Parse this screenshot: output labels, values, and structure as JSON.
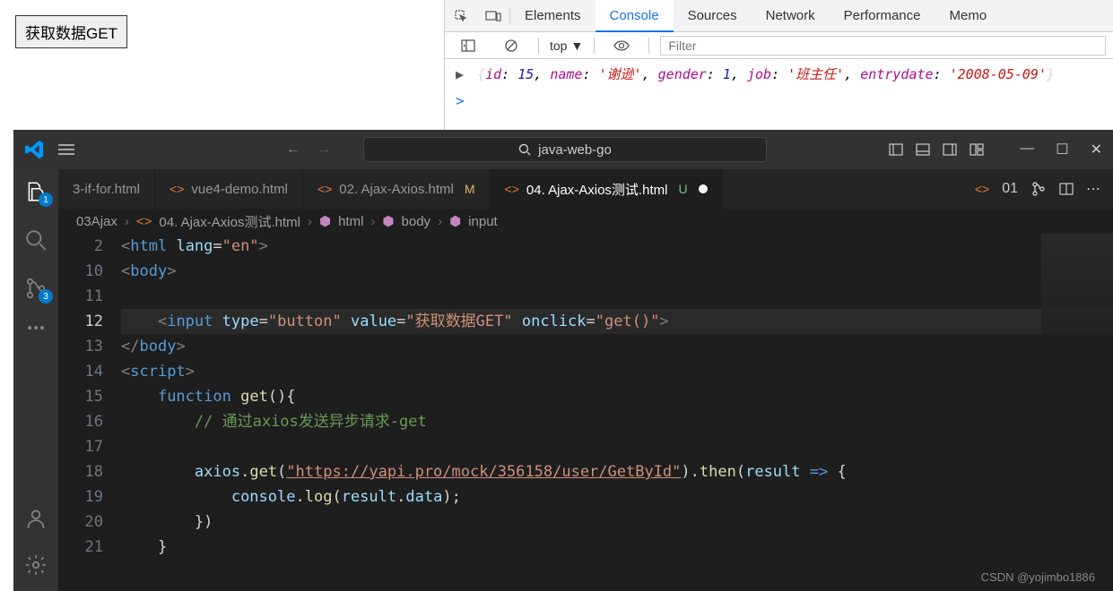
{
  "browser": {
    "button_label": "获取数据GET"
  },
  "devtools": {
    "tabs": [
      "Elements",
      "Console",
      "Sources",
      "Network",
      "Performance",
      "Memo"
    ],
    "active_tab": "Console",
    "context": "top",
    "filter_placeholder": "Filter",
    "console_output": {
      "id_key": "id",
      "id_val": "15",
      "name_key": "name",
      "name_val": "'谢逊'",
      "gender_key": "gender",
      "gender_val": "1",
      "job_key": "job",
      "job_val": "'班主任'",
      "entrydate_key": "entrydate",
      "entrydate_val": "'2008-05-09'"
    },
    "prompt": ">"
  },
  "vscode": {
    "search_text": "java-web-go",
    "activity_badge_files": "1",
    "activity_badge_scm": "3",
    "tabs": [
      {
        "label": "3-if-for.html",
        "status": ""
      },
      {
        "label": "vue4-demo.html",
        "status": ""
      },
      {
        "label": "02. Ajax-Axios.html",
        "status": "M"
      },
      {
        "label": "04. Ajax-Axios测试.html",
        "status": "U",
        "active": true,
        "dirty": true
      }
    ],
    "right_tab": "01",
    "breadcrumb": [
      "03Ajax",
      "04. Ajax-Axios测试.html",
      "html",
      "body",
      "input"
    ],
    "gutter": [
      "2",
      "10",
      "11",
      "12",
      "13",
      "14",
      "15",
      "16",
      "17",
      "18",
      "19",
      "20",
      "21"
    ],
    "code": {
      "l2": {
        "tag": "html",
        "attr": "lang",
        "val": "\"en\""
      },
      "l10": {
        "tag": "body"
      },
      "l12": {
        "tag": "input",
        "a1": "type",
        "v1": "\"button\"",
        "a2": "value",
        "v2": "\"获取数据GET\"",
        "a3": "onclick",
        "v3": "\"get()\""
      },
      "l13": {
        "tag": "body"
      },
      "l14": {
        "tag": "script"
      },
      "l15": {
        "kw": "function",
        "fn": "get"
      },
      "l16": {
        "comment": "// 通过axios发送异步请求-get"
      },
      "l18": {
        "obj": "axios",
        "m1": "get",
        "url": "\"https://yapi.pro/mock/356158/user/GetById\"",
        "m2": "then",
        "arg": "result"
      },
      "l19": {
        "obj": "console",
        "m": "log",
        "arg": "result",
        "prop": "data"
      }
    },
    "watermark": "CSDN @yojimbo1886"
  }
}
